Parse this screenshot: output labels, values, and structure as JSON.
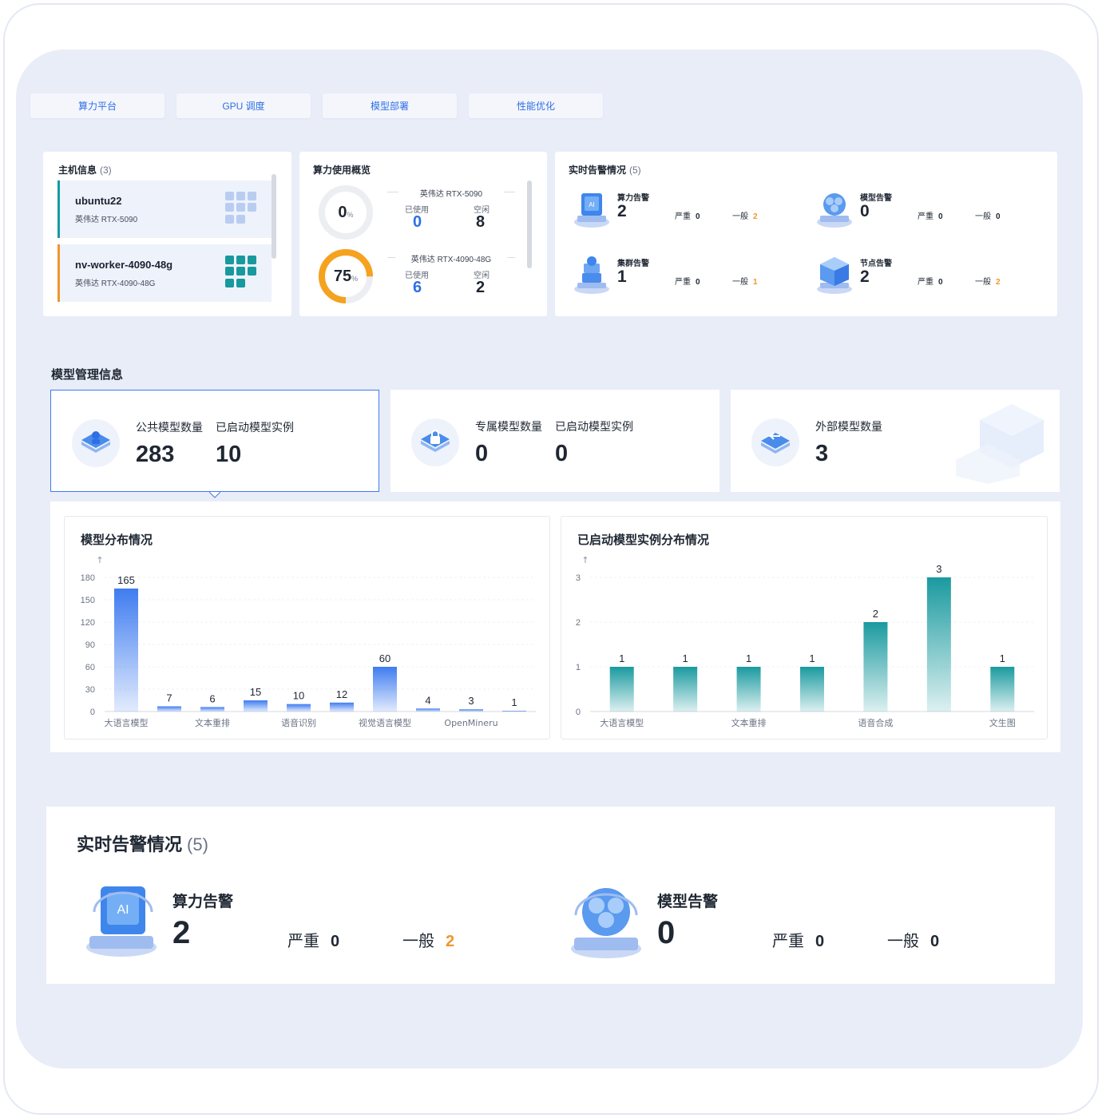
{
  "tabs": [
    "算力平台",
    "GPU 调度",
    "模型部署",
    "性能优化"
  ],
  "host_info": {
    "title": "主机信息",
    "count": "(3)",
    "hosts": [
      {
        "name": "ubuntu22",
        "model": "英伟达 RTX-5090",
        "color": "#169aa0"
      },
      {
        "name": "nv-worker-4090-48g",
        "model": "英伟达 RTX-4090-48G",
        "color": "#f0962b"
      }
    ]
  },
  "usage": {
    "title": "算力使用概览",
    "gauges": [
      {
        "value": "0",
        "unit": "%",
        "fraction": 0,
        "color": "#e9ebef"
      },
      {
        "value": "75",
        "unit": "%",
        "fraction": 0.75,
        "color": "#f5a21e"
      }
    ],
    "gpus": [
      {
        "name": "英伟达 RTX-5090",
        "used_label": "已使用",
        "used": "0",
        "free_label": "空闲",
        "free": "8"
      },
      {
        "name": "英伟达 RTX-4090-48G",
        "used_label": "已使用",
        "used": "6",
        "free_label": "空闲",
        "free": "2"
      }
    ]
  },
  "alerts": {
    "title": "实时告警情况",
    "count": "(5)",
    "severe_label": "严重",
    "general_label": "一般",
    "items": [
      {
        "name": "算力告警",
        "count": "2",
        "severe": "0",
        "general": "2",
        "icon": "ai-chip-icon"
      },
      {
        "name": "模型告警",
        "count": "0",
        "severe": "0",
        "general": "0",
        "icon": "model-cube-icon"
      },
      {
        "name": "集群告警",
        "count": "1",
        "severe": "0",
        "general": "1",
        "icon": "cluster-icon"
      },
      {
        "name": "节点告警",
        "count": "2",
        "severe": "0",
        "general": "2",
        "icon": "node-icon"
      }
    ]
  },
  "model_mgmt": {
    "title": "模型管理信息",
    "cards": [
      {
        "label1": "公共模型数量",
        "value1": "283",
        "label2": "已启动模型实例",
        "value2": "10",
        "icon": "public-model-icon"
      },
      {
        "label1": "专属模型数量",
        "value1": "0",
        "label2": "已启动模型实例",
        "value2": "0",
        "icon": "private-model-icon"
      },
      {
        "label1": "外部模型数量",
        "value1": "3",
        "icon": "external-model-icon"
      }
    ]
  },
  "chart_titles": {
    "left": "模型分布情况",
    "right": "已启动模型实例分布情况"
  },
  "chart_data": [
    {
      "type": "bar",
      "title": "模型分布情况",
      "categories": [
        "大语言模型",
        "",
        "文本重排",
        "",
        "语音识别",
        "",
        "视觉语言模型",
        "",
        "OpenMineru",
        ""
      ],
      "values": [
        165,
        7,
        6,
        15,
        10,
        12,
        60,
        4,
        3,
        1
      ],
      "ylim": [
        0,
        180
      ],
      "yticks": [
        0,
        30,
        60,
        90,
        120,
        150,
        180
      ],
      "color": "#3f7cf0",
      "y_axis_arrow": "↑"
    },
    {
      "type": "bar",
      "title": "已启动模型实例分布情况",
      "categories": [
        "大语言模型",
        "",
        "文本重排",
        "",
        "语音合成",
        "",
        "文生图"
      ],
      "values": [
        1,
        1,
        1,
        1,
        2,
        3,
        1
      ],
      "ylim": [
        0,
        3
      ],
      "yticks": [
        0,
        1,
        2,
        3
      ],
      "color": "#1a9a9f",
      "y_axis_arrow": "↑"
    }
  ],
  "big_alerts": {
    "title": "实时告警情况",
    "count": "(5)",
    "severe_label": "严重",
    "general_label": "一般",
    "items": [
      {
        "name": "算力告警",
        "count": "2",
        "severe": "0",
        "general": "2"
      },
      {
        "name": "模型告警",
        "count": "0",
        "severe": "0",
        "general": "0"
      }
    ]
  },
  "colors": {
    "accent": "#2f6fe4",
    "orange": "#f0962b",
    "teal": "#169aa0"
  }
}
